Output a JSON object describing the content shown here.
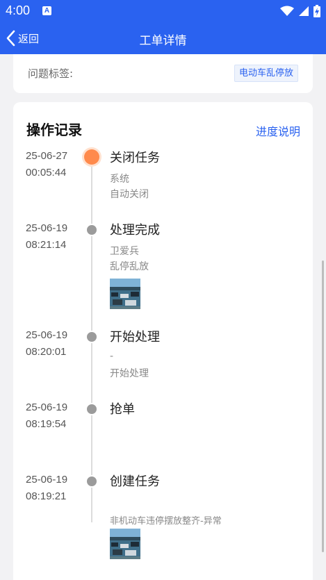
{
  "status_bar": {
    "time": "4:00",
    "notification_glyph": "A"
  },
  "header": {
    "back_label": "返回",
    "title": "工单详情"
  },
  "tag_card": {
    "label": "问题标签:",
    "tag": "电动车乱停放"
  },
  "records": {
    "title": "操作记录",
    "progress_link": "进度说明",
    "entries": [
      {
        "date": "25-06-27",
        "time": "00:05:44",
        "action": "关闭任务",
        "operator": "系统",
        "remark": "自动关闭",
        "active": true
      },
      {
        "date": "25-06-19",
        "time": "08:21:14",
        "action": "处理完成",
        "operator": "卫爱兵",
        "remark": "乱停乱放",
        "has_photo": true
      },
      {
        "date": "25-06-19",
        "time": "08:20:01",
        "action": "开始处理",
        "operator": "-",
        "remark": "开始处理"
      },
      {
        "date": "25-06-19",
        "time": "08:19:54",
        "action": "抢单",
        "operator": "",
        "remark": ""
      },
      {
        "date": "25-06-19",
        "time": "08:19:21",
        "action": "创建任务",
        "operator": "",
        "remark": "非机动车违停摆放整齐-异常",
        "has_photo": true
      }
    ]
  },
  "colors": {
    "primary": "#2a62f0",
    "active_dot": "#ff8a4c",
    "dot": "#9b9b9b",
    "page_bg": "#f2f2f4"
  }
}
